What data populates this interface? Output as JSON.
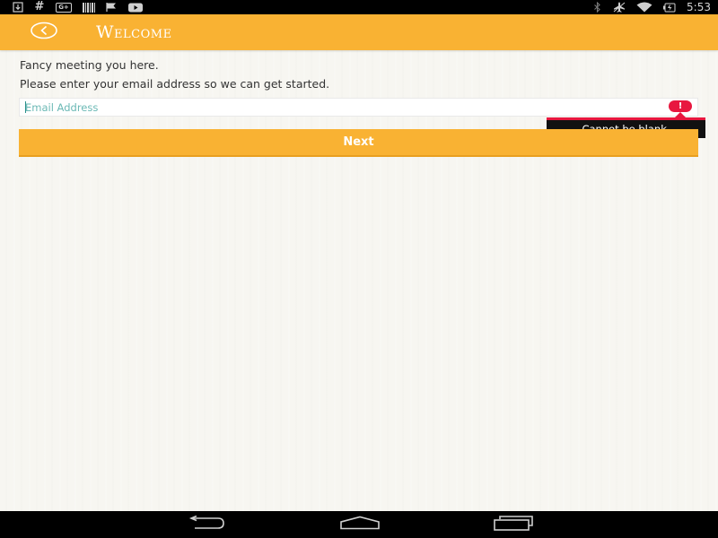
{
  "status_bar": {
    "left_icons": [
      "download-icon",
      "hash-icon",
      "google-plus-icon",
      "barcode-icon",
      "checkmark-flag-icon",
      "youtube-icon"
    ],
    "right_icons": [
      "bluetooth-icon",
      "airplane-mode-icon",
      "wifi-icon",
      "battery-icon"
    ],
    "time": "5:53",
    "google_plus_text": "G+",
    "hash_text": "#"
  },
  "action_bar": {
    "title": "Welcome",
    "back_icon": "back-arrow-circle-icon",
    "color": "#f9b233"
  },
  "content": {
    "intro_line_1": "Fancy meeting you here.",
    "intro_line_2": "Please enter your email address so we can get started.",
    "email_field": {
      "value": "",
      "placeholder": "Email Address"
    },
    "error": {
      "icon": "error-exclamation-icon",
      "message": "Cannot be blank.",
      "color": "#e8173f"
    },
    "next_button_label": "Next"
  },
  "nav_bar": {
    "buttons": [
      "back-nav-icon",
      "home-nav-icon",
      "recents-nav-icon"
    ]
  }
}
